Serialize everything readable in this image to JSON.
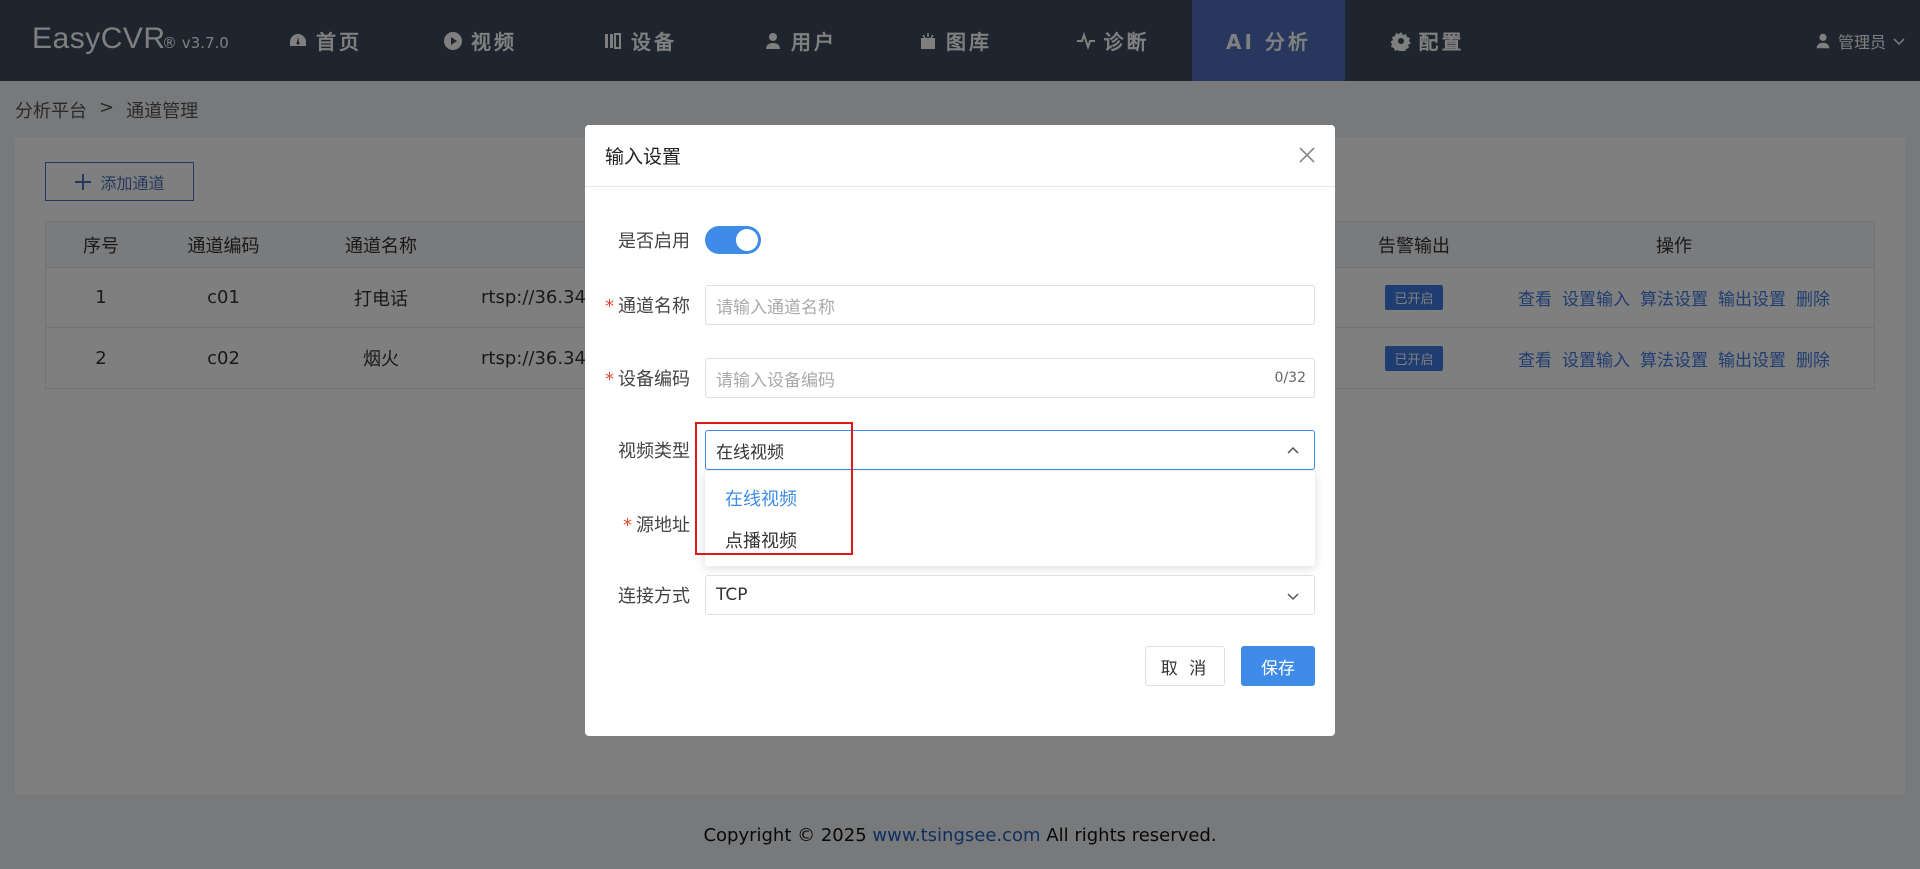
{
  "app": {
    "logo": "EasyCVR",
    "version": "® v3.7.0"
  },
  "nav": [
    {
      "label": "首页",
      "icon": "dashboard-icon"
    },
    {
      "label": "视频",
      "icon": "play-icon"
    },
    {
      "label": "设备",
      "icon": "device-icon"
    },
    {
      "label": "用户",
      "icon": "user-icon"
    },
    {
      "label": "图库",
      "icon": "gallery-icon"
    },
    {
      "label": "诊断",
      "icon": "pulse-icon"
    },
    {
      "label": "AI 分析",
      "icon": ""
    },
    {
      "label": "配置",
      "icon": "gear-icon"
    }
  ],
  "user": {
    "name": "管理员"
  },
  "breadcrumb": {
    "root": "分析平台",
    "sep": ">",
    "current": "通道管理"
  },
  "toolbar": {
    "add_label": "添加通道"
  },
  "table": {
    "headers": {
      "index": "序号",
      "code": "通道编码",
      "name": "通道名称",
      "alarm": "告警输出",
      "ops": "操作"
    },
    "rows": [
      {
        "index": "1",
        "code": "c01",
        "name": "打电话",
        "url": "rtsp://36.34",
        "alarm": "已开启"
      },
      {
        "index": "2",
        "code": "c02",
        "name": "烟火",
        "url": "rtsp://36.34",
        "alarm": "已开启"
      }
    ],
    "ops": [
      "查看",
      "设置输入",
      "算法设置",
      "输出设置",
      "删除"
    ]
  },
  "dialog": {
    "title": "输入设置",
    "enable_label": "是否启用",
    "enabled": true,
    "channel_name_label": "通道名称",
    "channel_name_placeholder": "请输入通道名称",
    "device_code_label": "设备编码",
    "device_code_placeholder": "请输入设备编码",
    "device_code_counter": "0/32",
    "video_type_label": "视频类型",
    "video_type_value": "在线视频",
    "video_type_options": [
      "在线视频",
      "点播视频"
    ],
    "source_label": "源地址",
    "connect_label": "连接方式",
    "connect_value": "TCP",
    "cancel_label": "取 消",
    "save_label": "保存"
  },
  "footer": {
    "prefix": "Copyright © 2025 ",
    "site": "www.tsingsee.com",
    "suffix": " All rights reserved."
  }
}
